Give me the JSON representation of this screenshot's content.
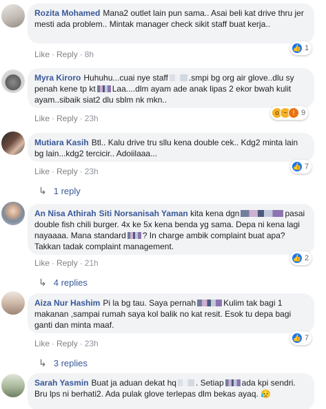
{
  "comments": [
    {
      "author": "Rozita Mohamed",
      "text": "Mana2 outlet lain pun sama.. Asai beli kat drive thru jer mesti ada problem.. Mintak manager check sikit staff buat kerja..",
      "like": "Like",
      "reply": "Reply",
      "time": "8h",
      "reactions": {
        "icons": [
          "like-icon"
        ],
        "count": "1"
      }
    },
    {
      "author": "Myra Kiroro",
      "text_a": "Huhuhu...cuai nye staff",
      "text_b": ".smpi bg org air glove..dlu sy penah kene tp kt",
      "text_c": "Laa....dlm ayam ade anak lipas 2 ekor bwah kulit ayam..sibaik siat2 dlu sblm nk mkn..",
      "like": "Like",
      "reply": "Reply",
      "time": "23h",
      "reactions": {
        "icons": [
          "wow-icon",
          "sad-icon",
          "angry-icon"
        ],
        "count": "9"
      }
    },
    {
      "author": "Mutiara Kasih",
      "text": "Btl.. Kalu drive tru sllu kena double cek.. Kdg2 minta lain bg lain...kdg2 tercicir.. Adoiilaaa...",
      "like": "Like",
      "reply": "Reply",
      "time": "23h",
      "reactions": {
        "icons": [
          "like-icon"
        ],
        "count": "7"
      },
      "replies": "1 reply"
    },
    {
      "author": "An Nisa Athirah",
      "mention": "Siti Norsanisah Yaman",
      "text_a": "kita kena dgn",
      "text_b": "pasai double fish chili burger. 4x ke 5x kena benda yg sama. Depa ni kena lagi nayaaaa. Mana standard",
      "text_c": "? In charge ambik complaint buat apa? Takkan tadak complaint management.",
      "like": "Like",
      "reply": "Reply",
      "time": "21h",
      "reactions": {
        "icons": [
          "like-icon"
        ],
        "count": "2"
      },
      "replies": "4 replies"
    },
    {
      "author": "Aiza Nur Hashim",
      "text_a": "Pi la bg tau. Saya pernah",
      "text_b": "Kulim tak bagi 1 makanan ,sampai rumah saya kol balik no kat resit. Esok tu depa bagi ganti dan minta maaf.",
      "like": "Like",
      "reply": "Reply",
      "time": "23h",
      "reactions": {
        "icons": [
          "like-icon"
        ],
        "count": "7"
      },
      "replies": "3 replies"
    },
    {
      "author": "Sarah Yasmin",
      "text_a": "Buat ja aduan dekat hq",
      "text_b": ". Setiap",
      "text_c": "ada kpi sendri. Bru lps ni berhati2. Ada pulak glove terlepas dlm bekas ayaq.",
      "emoji": "😥"
    }
  ],
  "colors": {
    "link": "#385898",
    "bubble": "#f2f3f5",
    "like_blue": "#1877f2"
  }
}
